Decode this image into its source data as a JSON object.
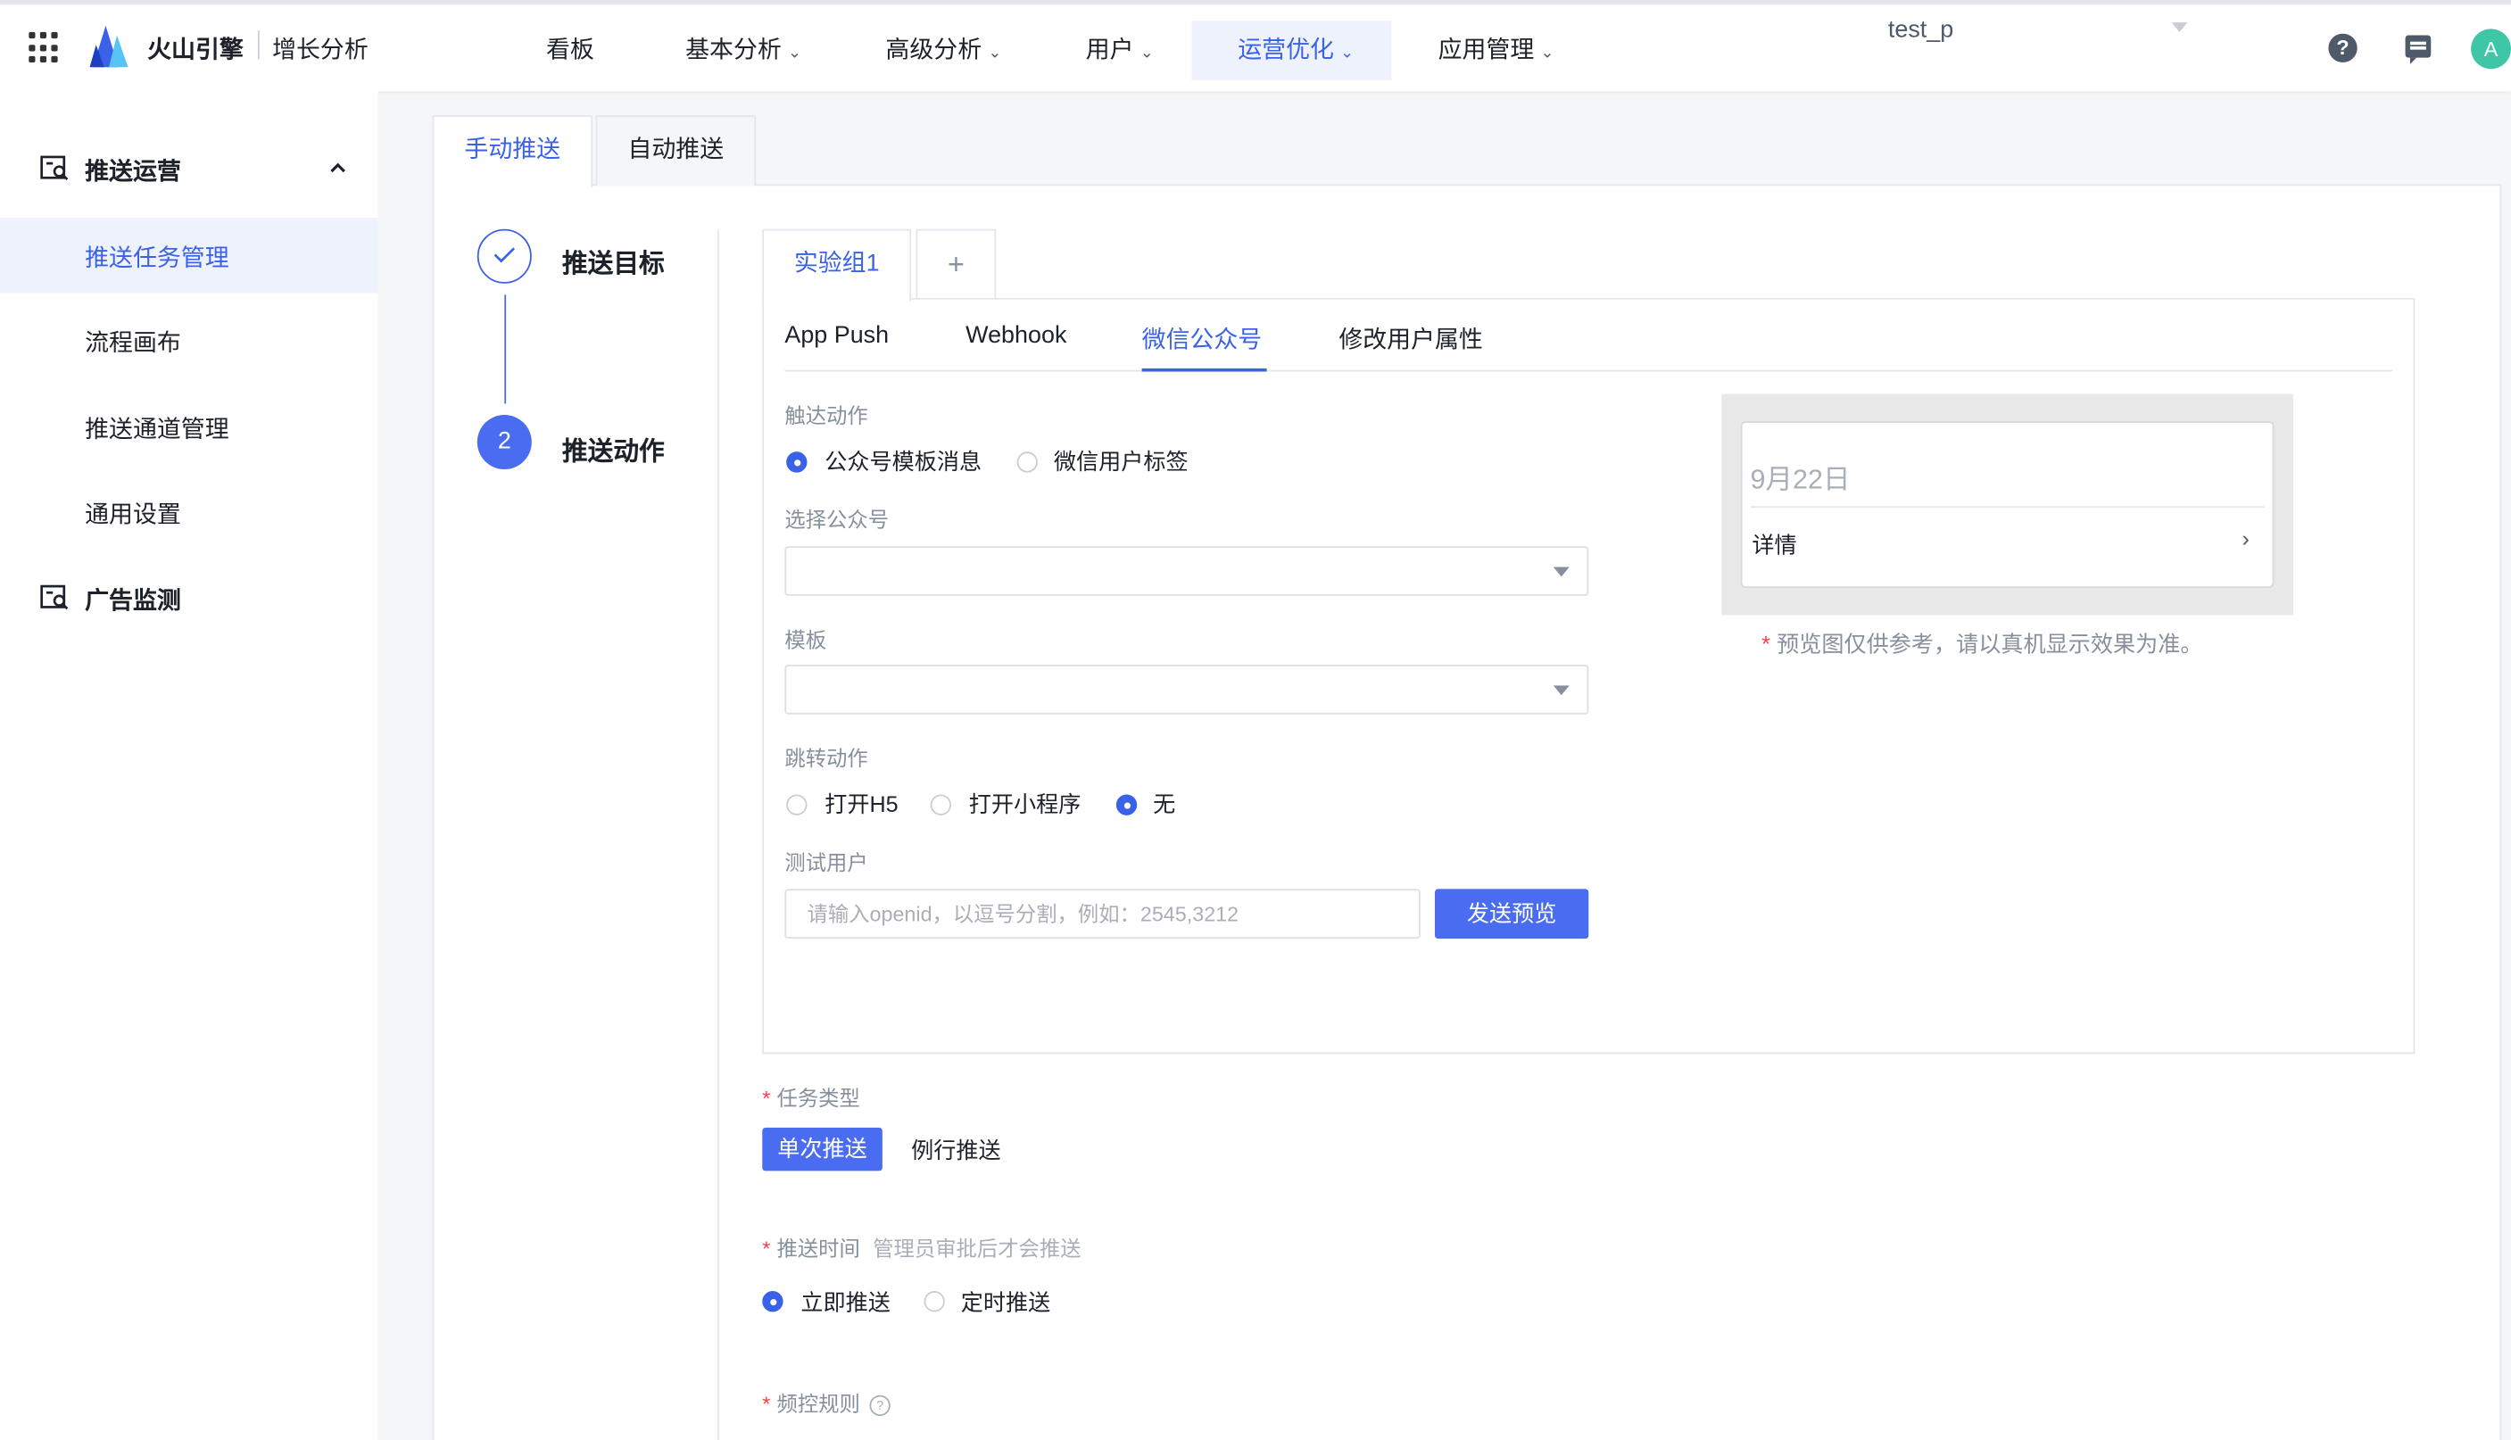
{
  "header": {
    "brand": "火山引擎",
    "product": "增长分析",
    "nav": [
      "看板",
      "基本分析",
      "高级分析",
      "用户",
      "运营优化",
      "应用管理"
    ],
    "project": "test_p",
    "avatar": "A",
    "help_glyph": "?"
  },
  "sidebar": {
    "section1_title": "推送运营",
    "items": [
      "推送任务管理",
      "流程画布",
      "推送通道管理",
      "通用设置"
    ],
    "section2_title": "广告监测"
  },
  "tabs": {
    "manual": "手动推送",
    "auto": "自动推送"
  },
  "steps": {
    "step1": "推送目标",
    "step2_num": "2",
    "step2": "推送动作"
  },
  "group": {
    "tab": "实验组1",
    "add": "+"
  },
  "channels": [
    "App Push",
    "Webhook",
    "微信公众号",
    "修改用户属性"
  ],
  "form": {
    "trigger_label": "触达动作",
    "trigger_opt1": "公众号模板消息",
    "trigger_opt2": "微信用户标签",
    "account_label": "选择公众号",
    "template_label": "模板",
    "jump_label": "跳转动作",
    "jump_opt1": "打开H5",
    "jump_opt2": "打开小程序",
    "jump_opt3": "无",
    "test_label": "测试用户",
    "test_placeholder": "请输入openid，以逗号分割，例如：2545,3212",
    "send_preview": "发送预览"
  },
  "preview": {
    "date": "9月22日",
    "detail": "详情",
    "arrow": "›",
    "note": "预览图仅供参考，请以真机显示效果为准。"
  },
  "task": {
    "req": "*",
    "type_label": "任务类型",
    "type_opt1": "单次推送",
    "type_opt2": "例行推送",
    "time_label": "推送时间",
    "time_hint": "管理员审批后才会推送",
    "time_opt1": "立即推送",
    "time_opt2": "定时推送",
    "freq_label": "频控规则",
    "freq_help": "?"
  }
}
